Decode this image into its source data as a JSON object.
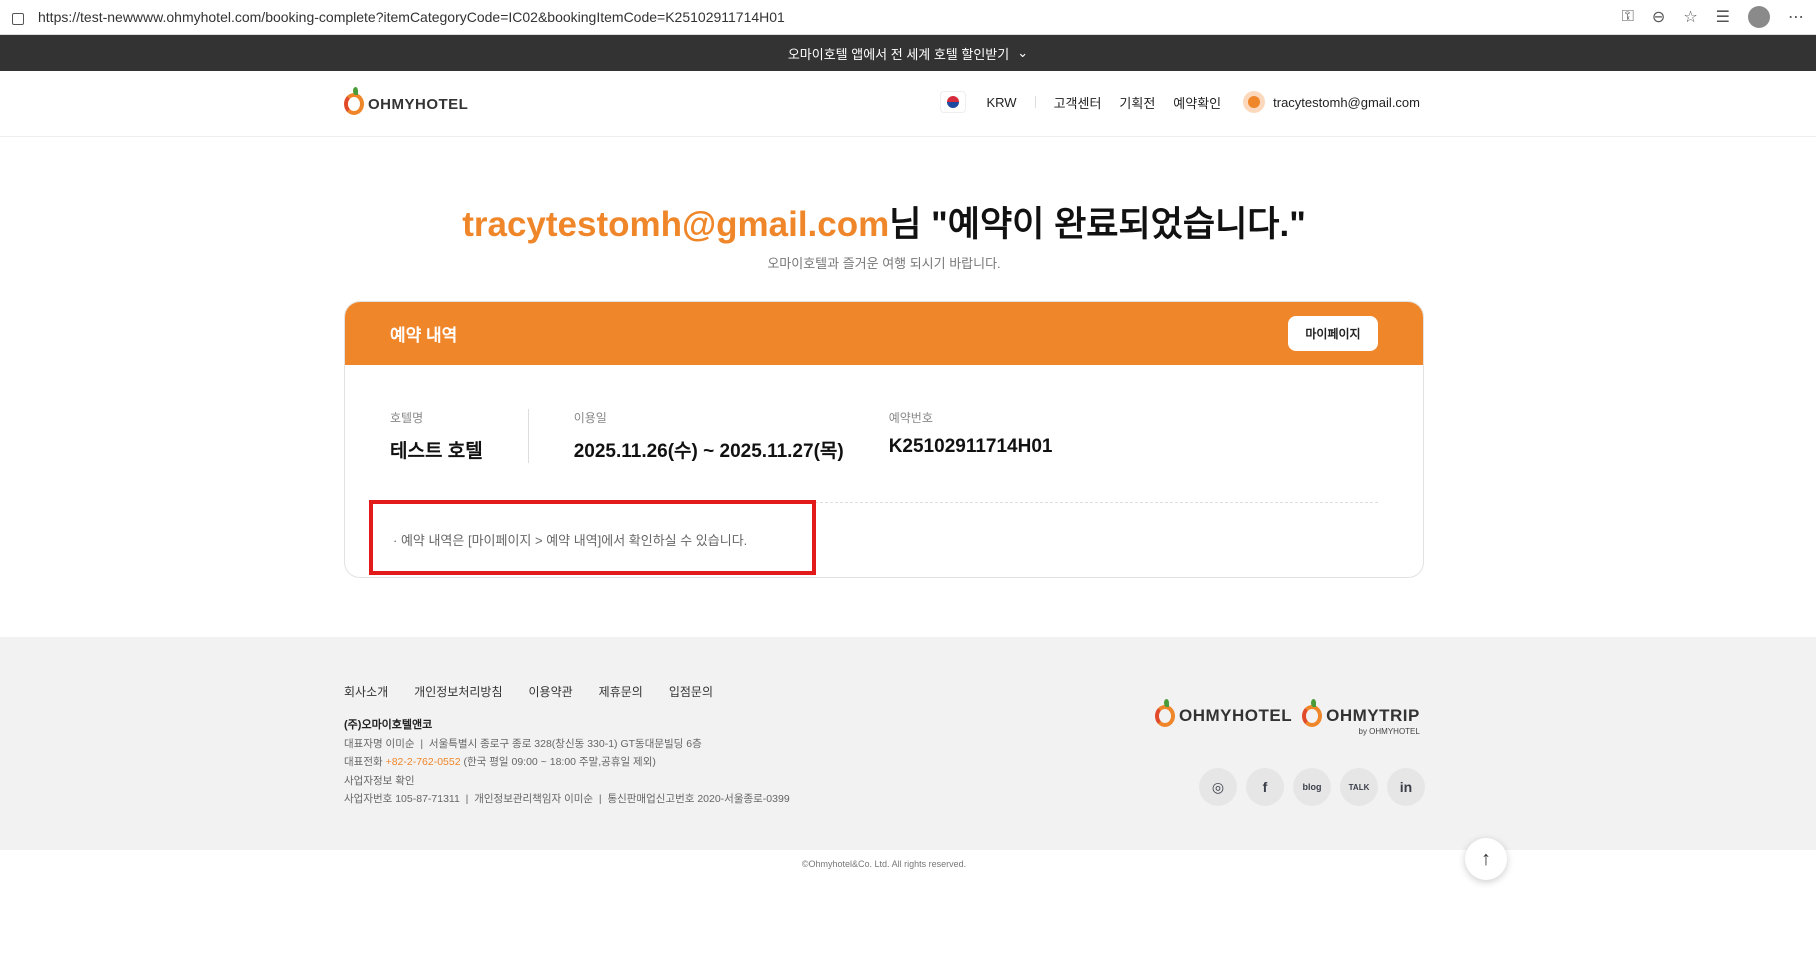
{
  "browser": {
    "url": "https://test-newwww.ohmyhotel.com/booking-complete?itemCategoryCode=IC02&bookingItemCode=K25102911714H01"
  },
  "promo": {
    "text": "오마이호텔 앱에서 전 세계 호텔 할인받기"
  },
  "header": {
    "logo": "OHMYHOTEL",
    "currency": "KRW",
    "links": [
      "고객센터",
      "기획전",
      "예약확인"
    ],
    "user": "tracytestomh@gmail.com"
  },
  "main": {
    "email": "tracytestomh@gmail.com",
    "title_suffix": "님 \"예약이 완료되었습니다.\"",
    "subtitle": "오마이호텔과 즐거운 여행 되시기 바랍니다.",
    "card": {
      "title": "예약 내역",
      "mypage_button": "마이페이지",
      "hotel_label": "호텔명",
      "hotel": "테스트 호텔",
      "date_label": "이용일",
      "date": "2025.11.26(수) ~ 2025.11.27(목)",
      "booking_label": "예약번호",
      "booking_no": "K25102911714H01",
      "note": "· 예약 내역은 [마이페이지 > 예약 내역]에서 확인하실 수 있습니다."
    }
  },
  "footer": {
    "links": [
      "회사소개",
      "개인정보처리방침",
      "이용약관",
      "제휴문의",
      "입점문의"
    ],
    "company": "(주)오마이호텔앤코",
    "line1": "대표자명 이미순  |  서울특별시 종로구 종로 328(창신동 330-1) GT동대문빌딩 6층",
    "phone_label": "대표전화 ",
    "phone": "+82-2-762-0552",
    "phone_hours": " (한국 평일 09:00 ~ 18:00 주말,공휴일 제외)",
    "biz_check": "사업자정보 확인",
    "line4": "사업자번호 105-87-71311  |  개인정보관리책임자 이미순  |  통신판매업신고번호 2020-서울종로-0399",
    "logo1": "OHMYHOTEL",
    "logo2": "OHMYTRIP",
    "logo2_sub": "by OHMYHOTEL",
    "copyright": "©Ohmyhotel&Co. Ltd. All rights reserved."
  },
  "colors": {
    "accent": "#f0862a",
    "highlight": "#e21a1a"
  }
}
